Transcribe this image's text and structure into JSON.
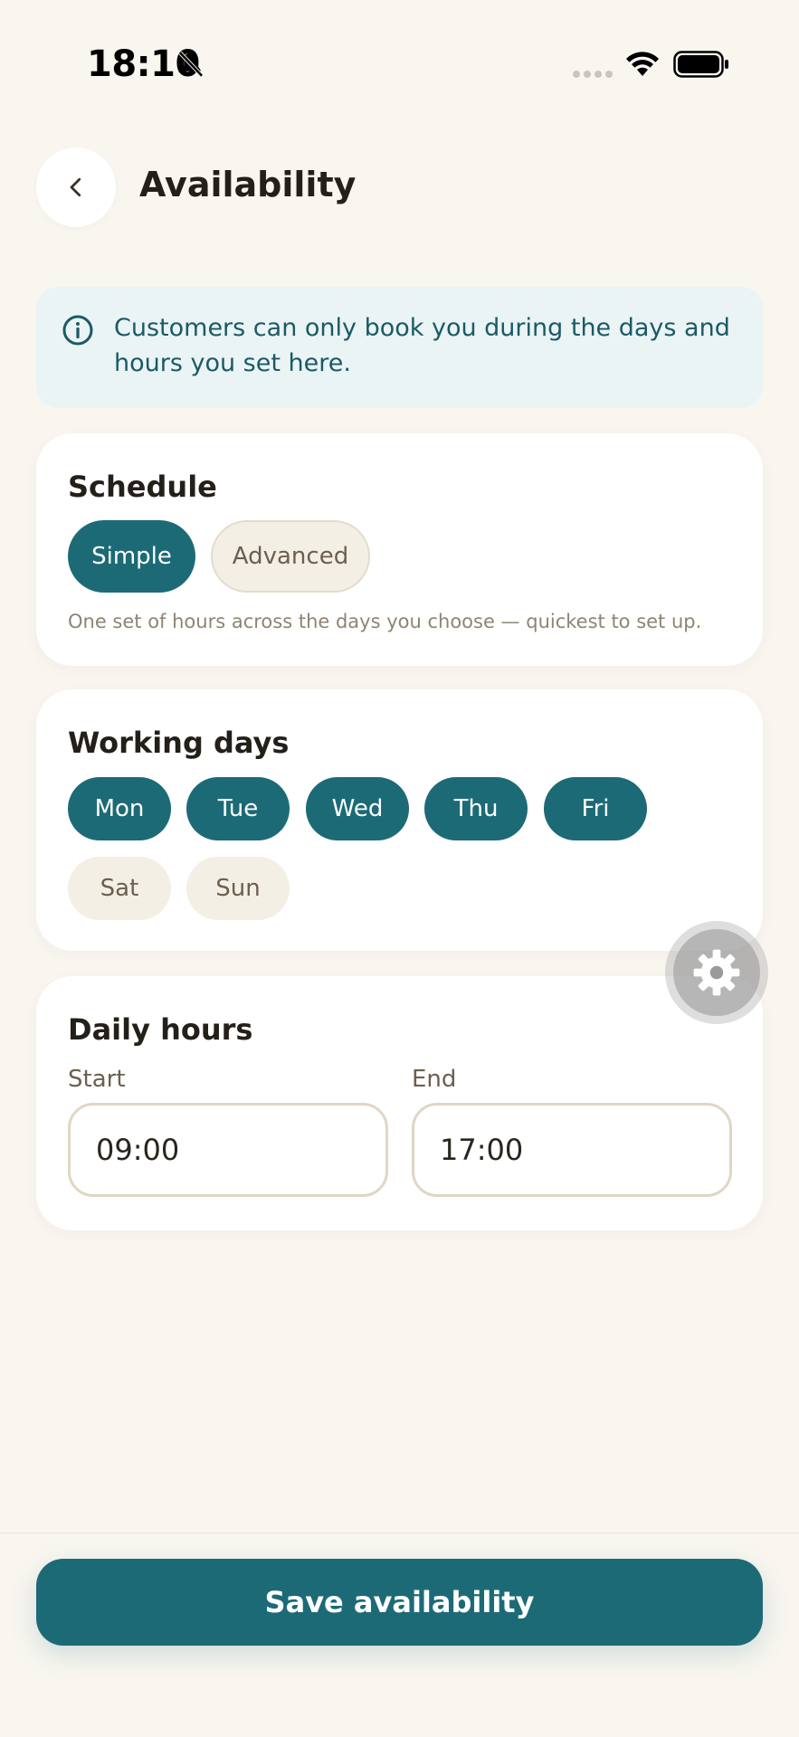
{
  "status_bar": {
    "time": "18:10",
    "icons": [
      "bell-off-icon",
      "signal-icon",
      "wifi-icon",
      "battery-icon"
    ]
  },
  "header": {
    "title": "Availability",
    "back_icon": "chevron-left-icon"
  },
  "info_banner": {
    "icon": "info-icon",
    "text": "Customers can only book you during the days and hours you set here."
  },
  "schedule": {
    "title": "Schedule",
    "options": [
      {
        "label": "Simple",
        "selected": true
      },
      {
        "label": "Advanced",
        "selected": false
      }
    ],
    "hint": "One set of hours across the days you choose — quickest to set up."
  },
  "working_days": {
    "title": "Working days",
    "days": [
      {
        "label": "Mon",
        "selected": true
      },
      {
        "label": "Tue",
        "selected": true
      },
      {
        "label": "Wed",
        "selected": true
      },
      {
        "label": "Thu",
        "selected": true
      },
      {
        "label": "Fri",
        "selected": true
      },
      {
        "label": "Sat",
        "selected": false
      },
      {
        "label": "Sun",
        "selected": false
      }
    ]
  },
  "daily_hours": {
    "title": "Daily hours",
    "start_label": "Start",
    "start_value": "09:00",
    "end_label": "End",
    "end_value": "17:00"
  },
  "floating_button": {
    "icon": "gear-icon"
  },
  "footer": {
    "save_label": "Save availability"
  },
  "colors": {
    "accent": "#1d6a77",
    "background": "#f9f6f0",
    "info_bg": "#ebf4f5",
    "chip_inactive": "#f3efe4"
  }
}
